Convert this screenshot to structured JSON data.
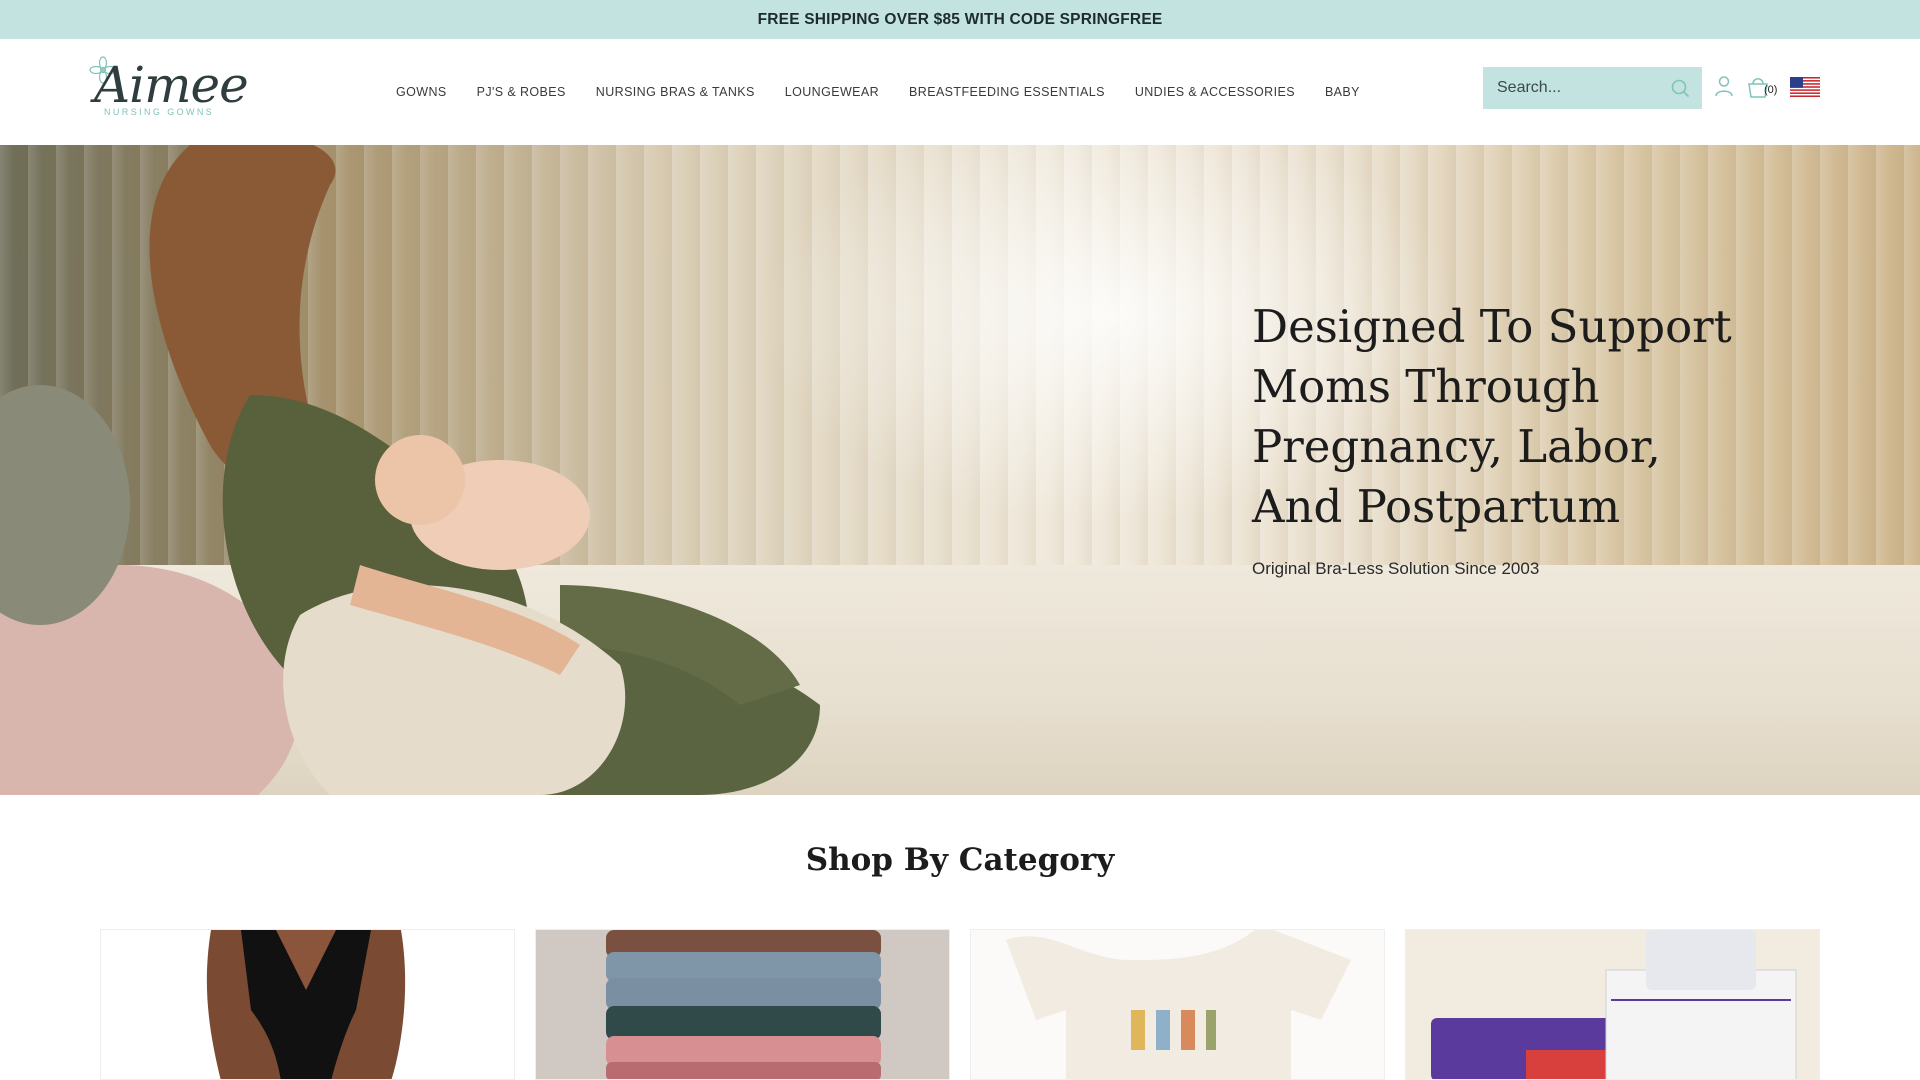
{
  "announcement": "FREE SHIPPING OVER $85 WITH CODE SPRINGFREE",
  "logo": {
    "word": "Aimee",
    "tagline": "NURSING GOWNS"
  },
  "nav": [
    "GOWNS",
    "PJ'S & ROBES",
    "NURSING BRAS & TANKS",
    "LOUNGEWEAR",
    "BREASTFEEDING ESSENTIALS",
    "UNDIES & ACCESSORIES",
    "BABY"
  ],
  "search": {
    "placeholder": "Search..."
  },
  "cart": {
    "count": "(0)"
  },
  "icons": {
    "search": "search-icon",
    "user": "user-icon",
    "cart": "cart-icon",
    "flag": "us-flag-icon",
    "logo_flower": "flower-icon"
  },
  "colors": {
    "accent": "#c3e3e0",
    "brand": "#7fc3bb",
    "text": "#1c1c1c"
  },
  "hero": {
    "title": "Designed To Support Moms Through Pregnancy, Labor, And Postpartum",
    "subtitle": "Original Bra-Less Solution Since 2003"
  },
  "category": {
    "title": "Shop By Category"
  },
  "category_cards": [
    {
      "image": "black-nursing-gown-photo"
    },
    {
      "image": "stacked-undies-photo"
    },
    {
      "image": "lil-bro-onesie-photo"
    },
    {
      "image": "breastmilk-storage-bags-photo"
    }
  ]
}
